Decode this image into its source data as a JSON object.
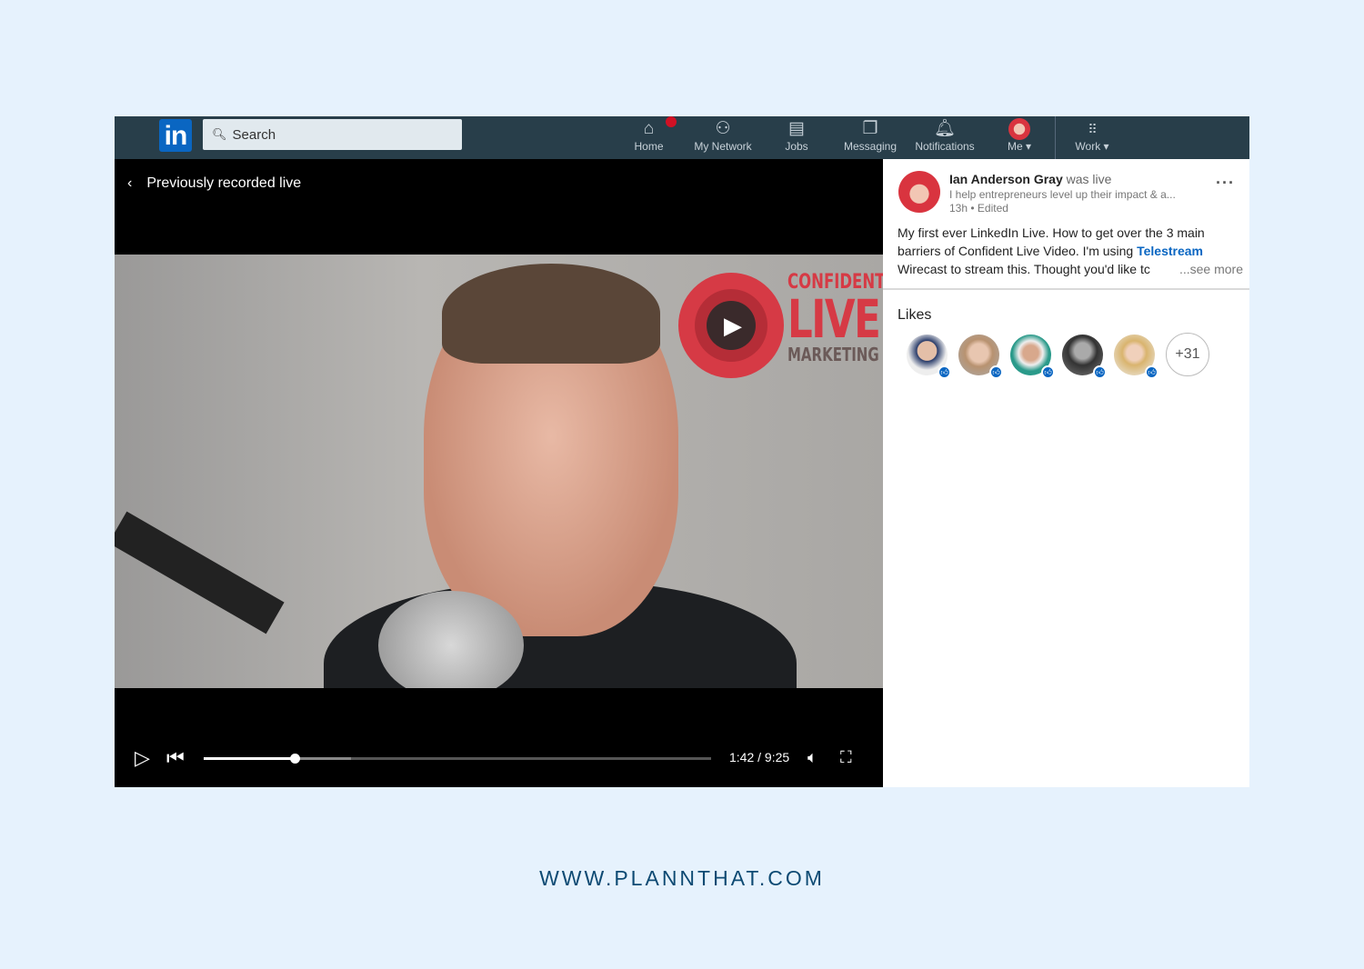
{
  "nav": {
    "logo_text": "in",
    "search_placeholder": "Search",
    "items": [
      {
        "label": "Home",
        "icon": "home-icon",
        "badge": true
      },
      {
        "label": "My Network",
        "icon": "network-icon"
      },
      {
        "label": "Jobs",
        "icon": "briefcase-icon"
      },
      {
        "label": "Messaging",
        "icon": "messaging-icon"
      },
      {
        "label": "Notifications",
        "icon": "bell-icon"
      },
      {
        "label": "Me ▾",
        "icon": "avatar"
      },
      {
        "label": "Work ▾",
        "icon": "grid-icon"
      }
    ]
  },
  "video": {
    "back_label": "Previously recorded live",
    "brand": {
      "line1": "CONFIDENT",
      "line2": "LIVE",
      "line3": "MARKETING"
    },
    "current_time": "1:42",
    "duration": "9:25",
    "time_display": "1:42 / 9:25",
    "progress": 0.18,
    "buffered": 0.29
  },
  "post": {
    "author": "Ian Anderson Gray",
    "status": "was live",
    "headline": "I help entrepreneurs level up their impact & a...",
    "meta": "13h • Edited",
    "text_before_link": "My first ever LinkedIn Live. How to get over the 3 main barriers of Confident Live Video. I'm using ",
    "link": "Telestream",
    "text_after_link": " Wirecast to stream this. Thought you'd like tc",
    "see_more": "...see more"
  },
  "likes": {
    "title": "Likes",
    "more_count": "+31"
  },
  "footer": {
    "url": "WWW.PLANNTHAT.COM"
  },
  "colors": {
    "nav_bg": "#283e4a",
    "brand_blue": "#0a66c2",
    "page_bg": "#e6f2fd",
    "brand_red": "#d63a45"
  }
}
